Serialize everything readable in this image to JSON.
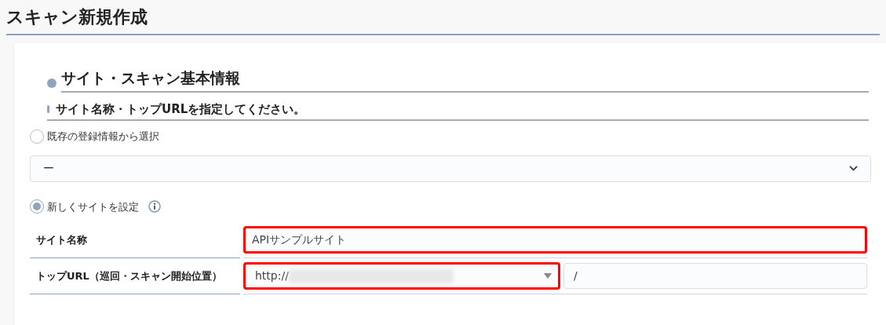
{
  "page_title": "スキャン新規作成",
  "section": {
    "title": "サイト・スキャン基本情報",
    "subtitle": "サイト名称・トップURLを指定してください。"
  },
  "options": [
    {
      "kind": "existing",
      "label": "既存の登録情報から選択",
      "selected": false,
      "select_value": "ー"
    },
    {
      "kind": "new",
      "label": "新しくサイトを設定",
      "selected": true
    }
  ],
  "fields": [
    {
      "kind": "text",
      "label": "サイト名称",
      "value": "APIサンプルサイト",
      "highlighted": true
    },
    {
      "kind": "url",
      "label": "トップURL（巡回・スキャン開始位置）",
      "scheme": "http://",
      "highlighted": true,
      "path": "/"
    }
  ]
}
